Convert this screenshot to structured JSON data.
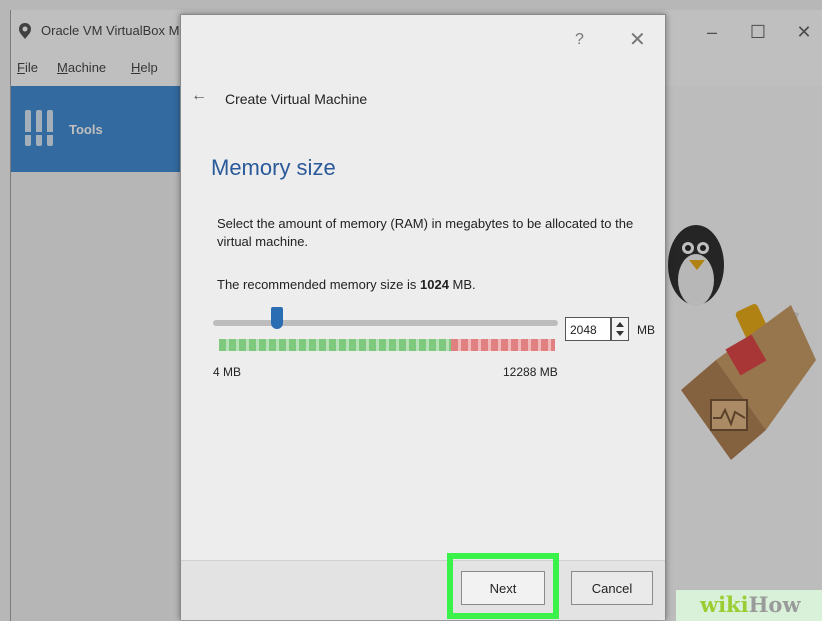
{
  "app": {
    "title": "Oracle VM VirtualBox M",
    "window_controls": {
      "minimize": "–",
      "maximize": "☐",
      "close": "✕"
    }
  },
  "menu": [
    {
      "label": "File",
      "accel": "F",
      "rest": "ile"
    },
    {
      "label": "Machine",
      "accel": "M",
      "rest": "achine"
    },
    {
      "label": "Help",
      "accel": "H",
      "rest": "elp"
    }
  ],
  "sidebar": {
    "tools_label": "Tools"
  },
  "dialog": {
    "help_glyph": "?",
    "close_glyph": "✕",
    "back_glyph": "←",
    "title": "Create Virtual Machine",
    "heading": "Memory size",
    "description": "Select the amount of memory (RAM) in megabytes to be allocated to the virtual machine.",
    "recommended_prefix": "The recommended memory size is ",
    "recommended_value": "1024",
    "recommended_suffix": " MB.",
    "slider": {
      "min_label": "4 MB",
      "max_label": "12288 MB",
      "value_mb": 2048,
      "min_mb": 4,
      "max_mb": 12288
    },
    "memory_input_value": "2048",
    "memory_unit": "MB",
    "next_label": "Next",
    "cancel_label": "Cancel"
  },
  "colors": {
    "accent": "#2f80cf",
    "heading": "#2a5a9a",
    "highlight": "#3bf24a",
    "scale_green": "#7fc97f",
    "scale_red": "#e08080"
  },
  "watermark": {
    "wiki": "wiki",
    "how": "How"
  }
}
